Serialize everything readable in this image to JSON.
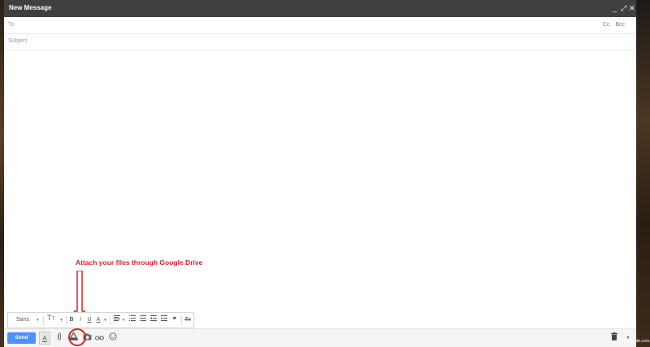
{
  "window": {
    "title": "New Message",
    "controls": {
      "minimize": "_",
      "popout": "⤢",
      "close": "✕"
    }
  },
  "compose": {
    "to_label": "To",
    "cc_label": "Cc",
    "bcc_label": "Bcc",
    "subject_placeholder": "Subject"
  },
  "annotation": {
    "text": "Attach your files through Google Drive",
    "color": "#d3262c"
  },
  "formatting": {
    "font_family": "Sans Serif",
    "size_icon": "text-size-icon",
    "bold": "B",
    "italic": "I",
    "underline": "U",
    "text_color": "A",
    "align_icon": "align-icon",
    "numbered_list_icon": "numbered-list-icon",
    "bulleted_list_icon": "bulleted-list-icon",
    "indent_less_icon": "indent-less-icon",
    "indent_more_icon": "indent-more-icon",
    "quote": "❞",
    "remove_format": "Tx"
  },
  "bottom_toolbar": {
    "send_label": "Send",
    "formatting_toggle": "A",
    "attach_icon": "paperclip-icon",
    "drive_icon": "google-drive-icon",
    "photo_icon": "camera-icon",
    "link_icon": "link-icon",
    "emoji_icon": "smiley-icon",
    "discard_icon": "trash-icon",
    "more_icon": "chevron-down-icon"
  },
  "colors": {
    "send_blue": "#4d90fe",
    "title_bar": "#404040"
  },
  "watermark": "wsxdn.com"
}
